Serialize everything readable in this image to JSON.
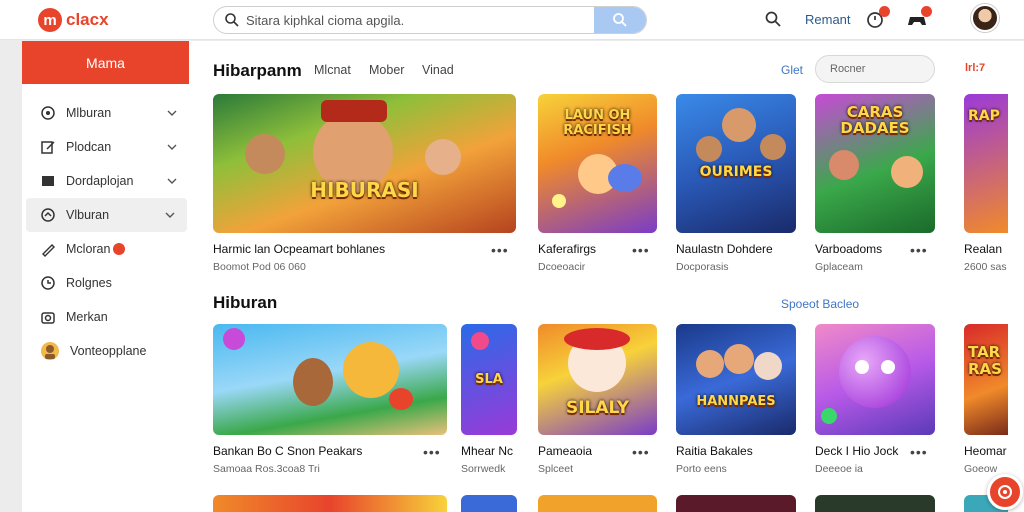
{
  "app": {
    "logo_letter": "m",
    "logo_text": "clacx"
  },
  "search": {
    "placeholder": "Sitara kiphkal cioma apgila."
  },
  "header": {
    "link": "Remant"
  },
  "sidebar": {
    "header": "Mama",
    "items": [
      {
        "label": "Mlburan",
        "icon": "circle-info-icon",
        "chevron": true
      },
      {
        "label": "Plodcan",
        "icon": "edit-icon",
        "chevron": true
      },
      {
        "label": "Dordaplojan",
        "icon": "square-icon",
        "chevron": true
      },
      {
        "label": "Vlburan",
        "icon": "gauge-icon",
        "chevron": true,
        "active": true
      },
      {
        "label": "Mcloran",
        "icon": "pen-icon",
        "badge": true
      },
      {
        "label": "Rolgnes",
        "icon": "clock-icon"
      },
      {
        "label": "Merkan",
        "icon": "camera-icon"
      },
      {
        "label": "Vonteopplane",
        "icon": "avatar-icon"
      }
    ]
  },
  "section1": {
    "title": "Hibarpanm",
    "tabs": [
      "Mlcnat",
      "Mober",
      "Vinad"
    ],
    "link": "Glet",
    "filter_placeholder": "Rocner",
    "extra_link": "lrl:7",
    "cards": [
      {
        "title": "Harmic lan Ocpeamart bohlanes",
        "sub": "Boomot Pod 06 060",
        "art": "HIBURASI"
      },
      {
        "title": "Kaferafirgs",
        "sub": "Dcoeoacir",
        "art": "LAUN OH\nRACIFISH"
      },
      {
        "title": "Naulastn Dohdere",
        "sub": "Docporasis",
        "art": "OURIMES"
      },
      {
        "title": "Varboadoms",
        "sub": "Gplaceam",
        "art": "CARAS\nDADAES"
      },
      {
        "title": "Realan",
        "sub": "2600 sas",
        "art": "RAP"
      }
    ]
  },
  "section2": {
    "title": "Hiburan",
    "link": "Spoeot Bacleo",
    "cards": [
      {
        "title": "Bankan Bo C Snon Peakars",
        "sub": "Samoaa Ros.3coa8 Tri",
        "art": ""
      },
      {
        "title": "Mhear Nc",
        "sub": "Sorrwedk",
        "art": "SLA"
      },
      {
        "title": "Pameaoia",
        "sub": "Splceet",
        "art": "SILALY"
      },
      {
        "title": "Raitia Bakales",
        "sub": "Porto eens",
        "art": "HANNPAES"
      },
      {
        "title": "Deck I Hio Jock",
        "sub": "Deeeoe ia",
        "art": ""
      },
      {
        "title": "Heomar",
        "sub": "Goeow",
        "art": "TAR\nRAS"
      }
    ]
  },
  "colors": {
    "accent": "#e8442c",
    "link": "#3f76c6",
    "search_button": "#a9c8f2"
  }
}
